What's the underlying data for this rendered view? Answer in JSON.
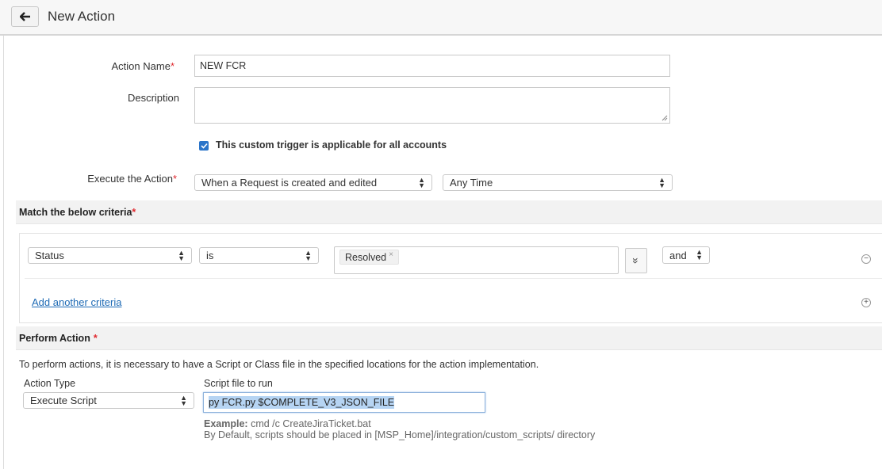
{
  "header": {
    "title": "New Action"
  },
  "form": {
    "action_name_label": "Action Name",
    "action_name_value": "NEW FCR",
    "description_label": "Description",
    "description_value": "",
    "custom_trigger_label": "This custom trigger is applicable for all accounts",
    "custom_trigger_checked": true,
    "execute_label": "Execute the Action",
    "execute_event": "When a Request is created and edited",
    "execute_time": "Any Time",
    "required_mark": "*"
  },
  "criteria_section": {
    "title": "Match the below criteria",
    "row": {
      "field": "Status",
      "operator": "is",
      "value_chip": "Resolved",
      "chip_remove": "×",
      "expand": "»",
      "conjunction": "and"
    },
    "add_link": "Add another criteria",
    "remove_icon": "−",
    "add_icon": "+"
  },
  "perform_section": {
    "title": "Perform Action",
    "info_text": "To perform actions, it is necessary to have a Script or Class file in the specified locations for the action implementation.",
    "action_type_label": "Action Type",
    "action_type_value": "Execute Script",
    "script_label": "Script file to run",
    "script_value": "py FCR.py $COMPLETE_V3_JSON_FILE",
    "example_label": "Example:",
    "example_value": " cmd /c CreateJiraTicket.bat",
    "default_text": "By Default, scripts should be placed in [MSP_Home]/integration/custom_scripts/ directory"
  }
}
